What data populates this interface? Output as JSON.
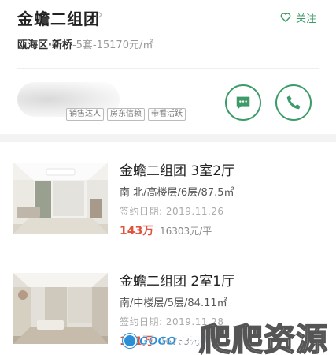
{
  "community": {
    "title": "金蟾二组团",
    "chevron": "›",
    "district": "瓯海区·新桥",
    "stats": "-5套-15170元/㎡",
    "follow_label": "关注"
  },
  "agent": {
    "tags": [
      "销售达人",
      "房东信赖",
      "带看活跃"
    ]
  },
  "listings": [
    {
      "title": "金蟾二组团 3室2厅",
      "spec": "南 北/高楼层/6层/87.5㎡",
      "date": "签约日期: 2019.11.26",
      "price": "143万",
      "unit_price": "16303元/平"
    },
    {
      "title": "金蟾二组团 2室1厅",
      "spec": "南/中楼层/5层/84.11㎡",
      "date": "签约日期: 2019.11.28",
      "price": "141万",
      "unit_price": "16763元/平"
    }
  ],
  "watermark": {
    "text": "爬爬资源",
    "logo_text": "GOGO手游网"
  },
  "colors": {
    "accent": "#3d9b6a",
    "price": "#e0533f",
    "text": "#222222",
    "muted": "#999999",
    "band": "#f3f3f3"
  }
}
